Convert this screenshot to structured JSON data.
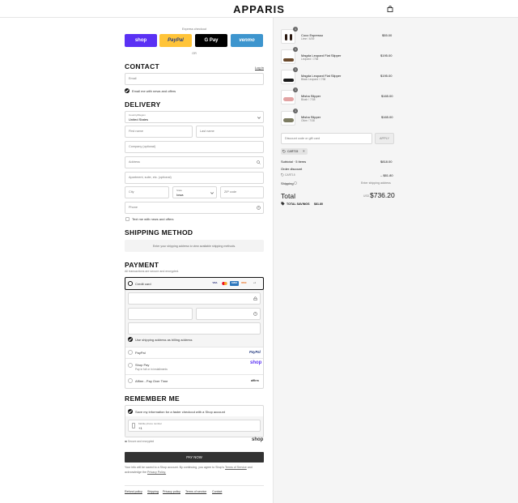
{
  "header": {
    "logo": "APPARIS",
    "bag_icon": "shopping-bag-icon"
  },
  "express": {
    "label": "Express checkout",
    "buttons": [
      {
        "label": "shop",
        "color": "#5a31f4",
        "text_color": "#ffffff"
      },
      {
        "label": "PayPal",
        "color": "#ffc439",
        "text_color": "#253b80"
      },
      {
        "label": "G Pay",
        "color": "#000000",
        "text_color": "#ffffff"
      },
      {
        "label": "venmo",
        "color": "#3d95ce",
        "text_color": "#ffffff"
      }
    ],
    "or": "OR"
  },
  "contact": {
    "heading": "CONTACT",
    "login": "Log in",
    "email_placeholder": "Email",
    "news_label": "Email me with news and offers"
  },
  "delivery": {
    "heading": "DELIVERY",
    "country_label": "Country/Region",
    "country_value": "United States",
    "first_name": "First name",
    "last_name": "Last name",
    "company": "Company (optional)",
    "address": "Address",
    "apartment": "Apartment, suite, etc. (optional)",
    "city": "City",
    "state_label": "State",
    "state_value": "Iowa",
    "zip": "ZIP code",
    "phone": "Phone",
    "text_label": "Text me with news and offers"
  },
  "shipping": {
    "heading": "SHIPPING METHOD",
    "message": "Enter your shipping address to view available shipping methods."
  },
  "payment": {
    "heading": "PAYMENT",
    "subtitle": "All transactions are secure and encrypted.",
    "credit_card": "Credit card",
    "card_brands": [
      "VISA",
      "MC",
      "AMEX",
      "DISC",
      "+4"
    ],
    "billing_label": "Use shipping address as billing address",
    "paypal": "PayPal",
    "paypal_logo": "PayPal",
    "shop_pay": "Shop Pay",
    "shop_pay_sub": "Pay in full or in installments",
    "shop_logo": "shop",
    "affirm": "Affirm - Pay Over Time",
    "affirm_logo": "affirm"
  },
  "remember": {
    "heading": "REMEMBER ME",
    "save_label": "Save my information for a faster checkout with a Shop account",
    "mobile_label": "Mobile phone number",
    "mobile_value": "+1",
    "secure_label": "Secure and encrypted",
    "shop_logo": "shop"
  },
  "pay_now": "PAY NOW",
  "legal": {
    "text": "Your info will be saved to a Shop account. By continuing, you agree to Shop's",
    "terms": "Terms of Service",
    "and": "and acknowledge the",
    "privacy": "Privacy Policy."
  },
  "footer_links": [
    "Refund policy",
    "Shipping",
    "Privacy policy",
    "Terms of service",
    "Contact"
  ],
  "order": {
    "items": [
      {
        "name": "Coco Espresso",
        "variant": "Lime / 6/39",
        "price": "$55.00",
        "qty": "1",
        "color": "#2b1a12",
        "accent": "#d08a3a"
      },
      {
        "name": "Magda Leopard Flat Slipper",
        "variant": "Leopard / 7/38",
        "price": "$195.00",
        "qty": "1",
        "color": "#6b4a2c",
        "accent": "#c99a5b"
      },
      {
        "name": "Magda Leopard Flat Slipper",
        "variant": "Black Leopard / 7/38",
        "price": "$195.00",
        "qty": "1",
        "color": "#1a1a1a",
        "accent": "#555555"
      },
      {
        "name": "Misha Slipper",
        "variant": "Blush / 7/38",
        "price": "$165.00",
        "qty": "1",
        "color": "#e2a3a3",
        "accent": "#c57b7b"
      },
      {
        "name": "Misha Slipper",
        "variant": "Olive / 7/38",
        "price": "$165.00",
        "qty": "1",
        "color": "#7d7c62",
        "accent": "#5e5d49"
      }
    ],
    "discount_placeholder": "Discount code or gift card",
    "apply": "APPLY",
    "code_tag": "CART15",
    "subtotal_label": "Subtotal · 5 items",
    "subtotal": "$818.00",
    "order_discount_label": "Order discount",
    "discount_code": "CART15",
    "discount_value": "– $81.80",
    "shipping_label": "Shipping",
    "shipping_value": "Enter shipping address",
    "total_label": "Total",
    "currency": "USD",
    "total": "$736.20",
    "savings_label": "TOTAL SAVINGS",
    "savings": "$81.80"
  }
}
